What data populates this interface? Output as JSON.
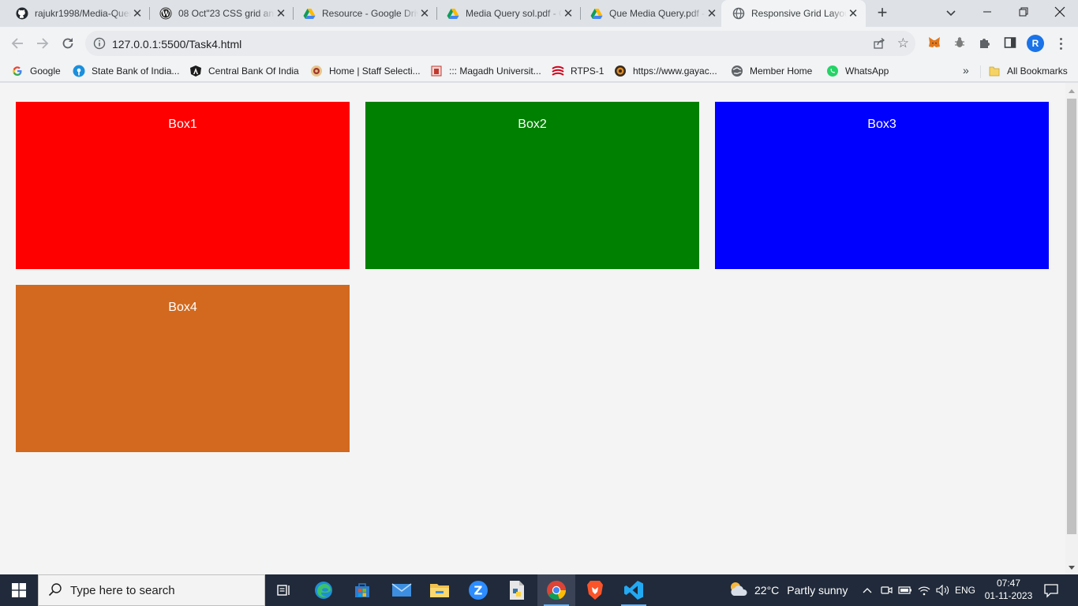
{
  "browser": {
    "tabs": [
      {
        "title": "rajukr1998/Media-Query",
        "icon": "github-icon"
      },
      {
        "title": "08 Oct\"23 CSS grid and",
        "icon": "wordpress-icon"
      },
      {
        "title": "Resource - Google Drive",
        "icon": "google-drive-icon"
      },
      {
        "title": "Media Query sol.pdf - Google",
        "icon": "google-drive-icon"
      },
      {
        "title": "Que Media Query.pdf - Google",
        "icon": "google-drive-icon"
      },
      {
        "title": "Responsive Grid Layout",
        "icon": "globe-icon"
      }
    ],
    "active_tab": 5,
    "url": "127.0.0.1:5500/Task4.html",
    "profile_initial": "R",
    "bookmarks": [
      {
        "label": "Google",
        "icon": "google-icon"
      },
      {
        "label": "State Bank of India...",
        "icon": "sbi-icon"
      },
      {
        "label": "Central Bank Of India",
        "icon": "central-bank-icon"
      },
      {
        "label": "Home | Staff Selecti...",
        "icon": "ssc-icon"
      },
      {
        "label": "::: Magadh Universit...",
        "icon": "magadh-university-icon"
      },
      {
        "label": "RTPS-1",
        "icon": "rtps-icon"
      },
      {
        "label": "https://www.gayac...",
        "icon": "gaya-icon"
      },
      {
        "label": "Member Home",
        "icon": "globe-icon"
      },
      {
        "label": "WhatsApp",
        "icon": "whatsapp-icon"
      }
    ],
    "all_bookmarks_label": "All Bookmarks",
    "more_bookmarks": "»"
  },
  "page": {
    "boxes": [
      {
        "label": "Box1",
        "color": "#ff0000"
      },
      {
        "label": "Box2",
        "color": "#008000"
      },
      {
        "label": "Box3",
        "color": "#0000ff"
      },
      {
        "label": "Box4",
        "color": "#d2691e"
      }
    ]
  },
  "taskbar": {
    "search_placeholder": "Type here to search",
    "weather": {
      "temp": "22°C",
      "condition": "Partly sunny"
    },
    "language": "ENG",
    "time": "07:47",
    "date": "01-11-2023"
  }
}
